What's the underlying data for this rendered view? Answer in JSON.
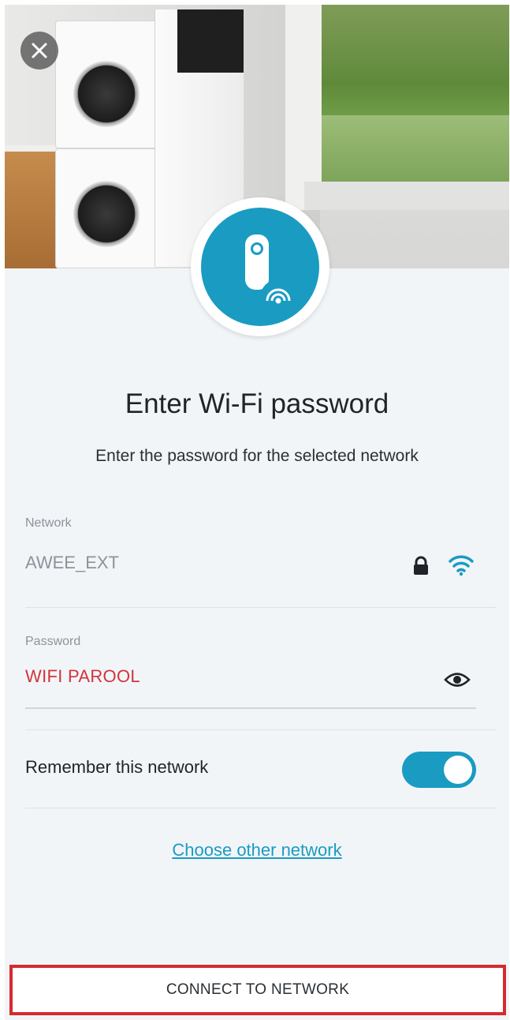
{
  "header": {
    "close_icon": "close-icon",
    "device_icon": "wifi-extender-icon"
  },
  "main": {
    "title": "Enter Wi-Fi password",
    "subtitle": "Enter the password for the selected network"
  },
  "network": {
    "label": "Network",
    "value": "AWEE_EXT",
    "icons": [
      "lock-icon",
      "wifi-icon"
    ]
  },
  "password": {
    "label": "Password",
    "value": "WIFI PAROOL",
    "toggle_icon": "eye-icon"
  },
  "remember": {
    "label": "Remember this network",
    "enabled": true
  },
  "links": {
    "choose_other": "Choose other network"
  },
  "footer": {
    "connect_label": "CONNECT TO NETWORK"
  },
  "colors": {
    "accent": "#1a9bc2",
    "password_text": "#d2343c",
    "highlight_border": "#d62a2f",
    "background": "#f2f5f8"
  }
}
